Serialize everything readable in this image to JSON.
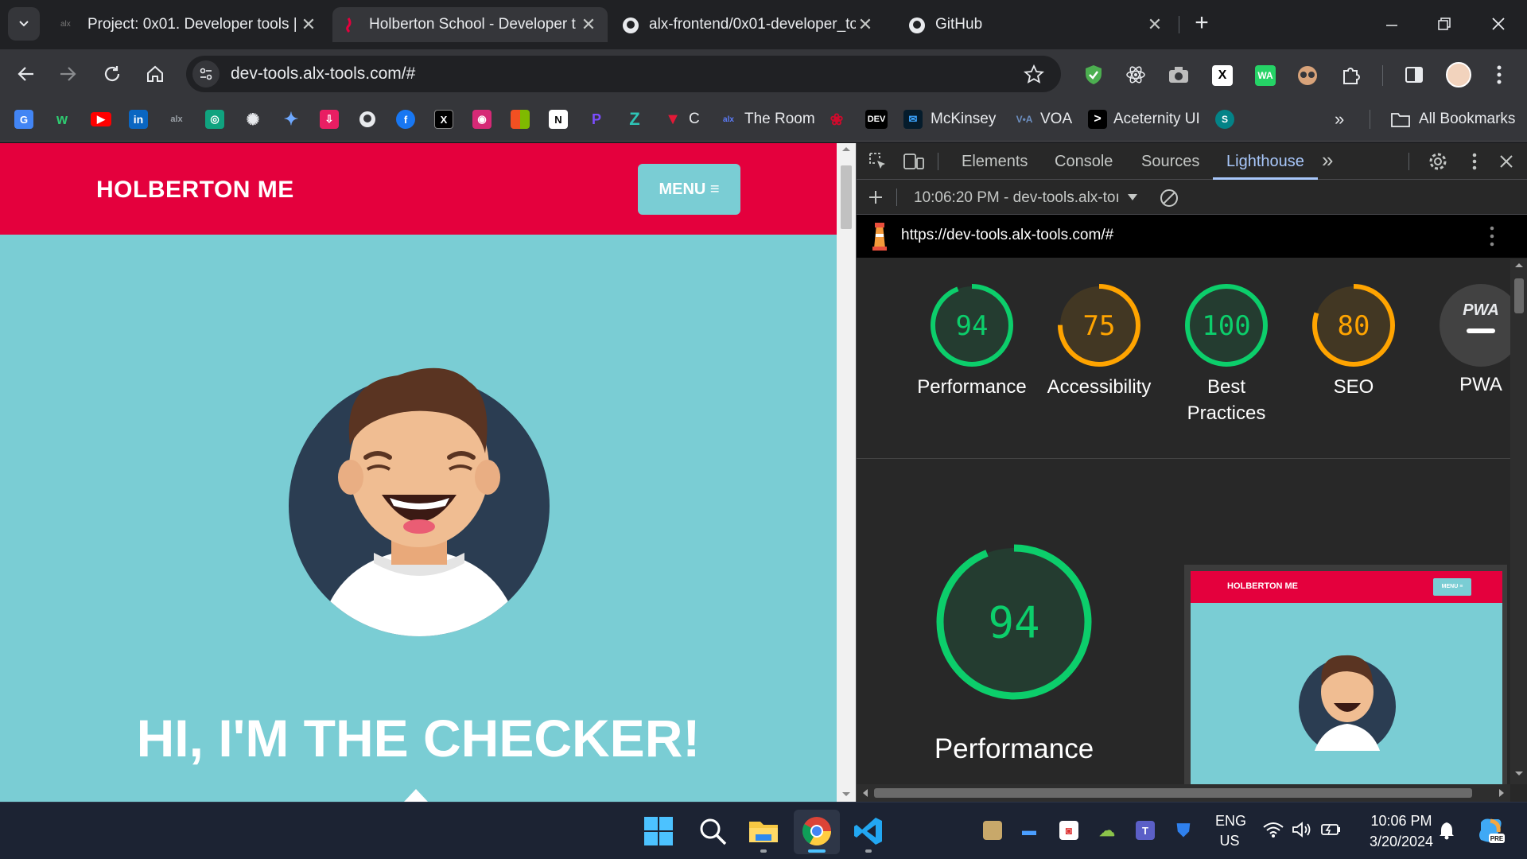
{
  "browser": {
    "tabs": [
      {
        "title": "Project: 0x01. Developer tools |",
        "active": false,
        "favicon": "alx-icon"
      },
      {
        "title": "Holberton School - Developer t",
        "active": true,
        "favicon": "holberton-icon"
      },
      {
        "title": "alx-frontend/0x01-developer_to",
        "active": false,
        "favicon": "github-icon"
      },
      {
        "title": "GitHub",
        "active": false,
        "favicon": "github-icon"
      }
    ],
    "new_tab": "+",
    "address": "dev-tools.alx-tools.com/#",
    "bookmarks": [
      {
        "label": "C",
        "icon": "tesla-icon"
      },
      {
        "label": "The Room",
        "icon": "alx-icon"
      },
      {
        "label": "McKinsey",
        "icon": "mckinsey-icon"
      },
      {
        "label": "VOA",
        "icon": "voa-icon"
      },
      {
        "label": "Aceternity UI",
        "icon": "aceternity-icon"
      }
    ],
    "all_bookmarks": "All Bookmarks",
    "overflow": "»"
  },
  "site": {
    "brand": "HOLBERTON ME",
    "menu_label": "MENU ≡",
    "hero_title": "HI, I'M THE CHECKER!"
  },
  "devtools": {
    "tabs": [
      "Elements",
      "Console",
      "Sources",
      "Lighthouse"
    ],
    "active_tab": "Lighthouse",
    "more": "»",
    "report_label": "10:06:20 PM - dev-tools.alx-toı",
    "url": "https://dev-tools.alx-tools.com/#",
    "scores": [
      {
        "value": "94",
        "label": "Performance",
        "score": 0.94,
        "color": "#0cce6b"
      },
      {
        "value": "75",
        "label": "Accessibility",
        "score": 0.75,
        "color": "#ffa400"
      },
      {
        "value": "100",
        "label": "Best Practices",
        "score": 1.0,
        "color": "#0cce6b"
      },
      {
        "value": "80",
        "label": "SEO",
        "score": 0.8,
        "color": "#ffa400"
      }
    ],
    "pwa": {
      "badge": "PWA",
      "label": "PWA"
    },
    "big_score": {
      "value": "94",
      "label": "Performance",
      "score": 0.94
    },
    "thumb_brand": "HOLBERTON ME",
    "thumb_menu": "MENU ≡"
  },
  "taskbar": {
    "lang": "ENG",
    "region": "US",
    "time": "10:06 PM",
    "date": "3/20/2024"
  }
}
